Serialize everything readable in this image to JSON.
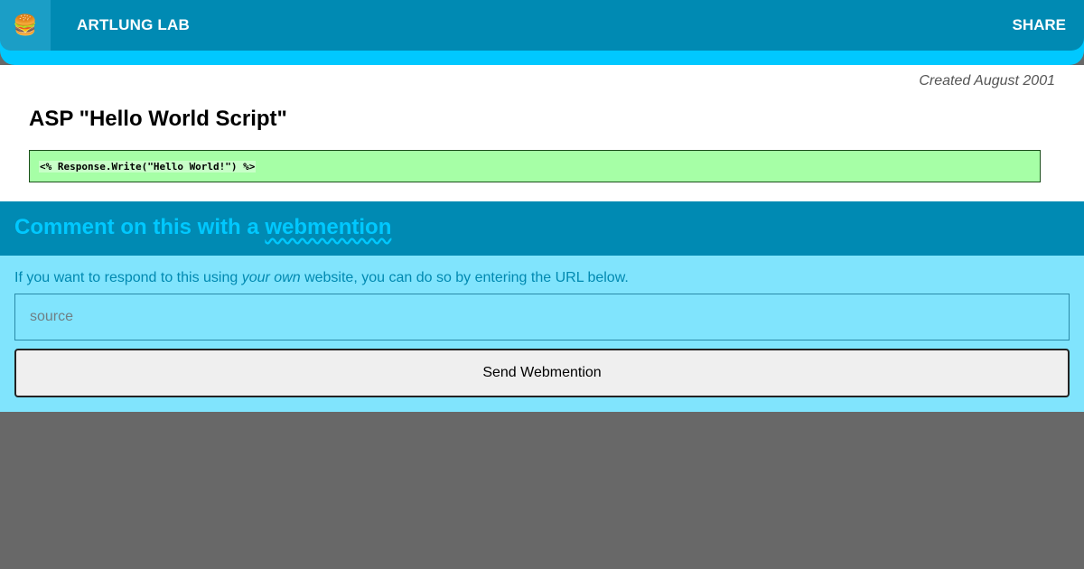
{
  "header": {
    "menu_icon": "🍔",
    "site_title": "ARTLUNG LAB",
    "share_label": "SHARE"
  },
  "post": {
    "created": "Created August 2001",
    "title": "ASP \"Hello World Script\"",
    "code": "<% Response.Write(\"Hello World!\") %>"
  },
  "comments": {
    "heading_prefix": "Comment on this with a ",
    "heading_link": "webmention",
    "intro_before": "If you want to respond to this using ",
    "intro_emphasis": "your own",
    "intro_after": " website, you can do so by entering the URL below.",
    "source_placeholder": "source",
    "source_value": "",
    "send_label": "Send Webmention"
  },
  "colors": {
    "header_bg": "#008ab3",
    "accent": "#00c8ff",
    "comment_bg": "#80e4fd",
    "code_bg": "#a6ffa6",
    "page_bg": "#686868"
  }
}
